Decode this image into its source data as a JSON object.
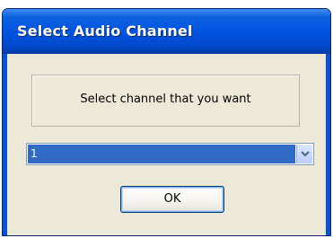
{
  "window": {
    "title": "Select Audio Channel"
  },
  "message": {
    "text": "Select channel that you want"
  },
  "channel_select": {
    "value": "1"
  },
  "ok_button": {
    "label": "OK"
  },
  "colors": {
    "titlebar": "#0054e3",
    "dialog_background": "#ece9d8",
    "selection": "#316ac5"
  },
  "icons": {
    "dropdown": "chevron-down-icon"
  }
}
